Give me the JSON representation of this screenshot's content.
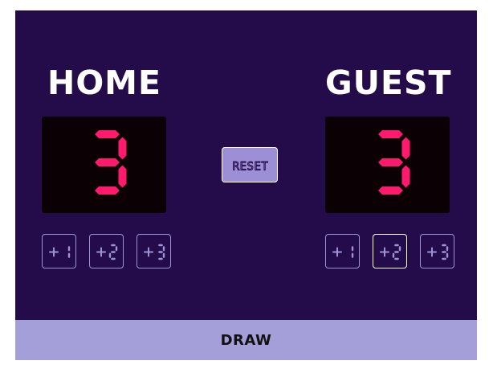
{
  "home": {
    "name": "HOME",
    "score": "3",
    "buttons": [
      "+1",
      "+2",
      "+3"
    ]
  },
  "guest": {
    "name": "GUEST",
    "score": "3",
    "buttons": [
      "+1",
      "+2",
      "+3"
    ]
  },
  "reset_label": "RESET",
  "status": "DRAW",
  "colors": {
    "board": "#240c4b",
    "display": "#0b0003",
    "digit": "#ff1a6d",
    "button_border": "#9f92d4",
    "status_bar": "#a49fd8"
  }
}
